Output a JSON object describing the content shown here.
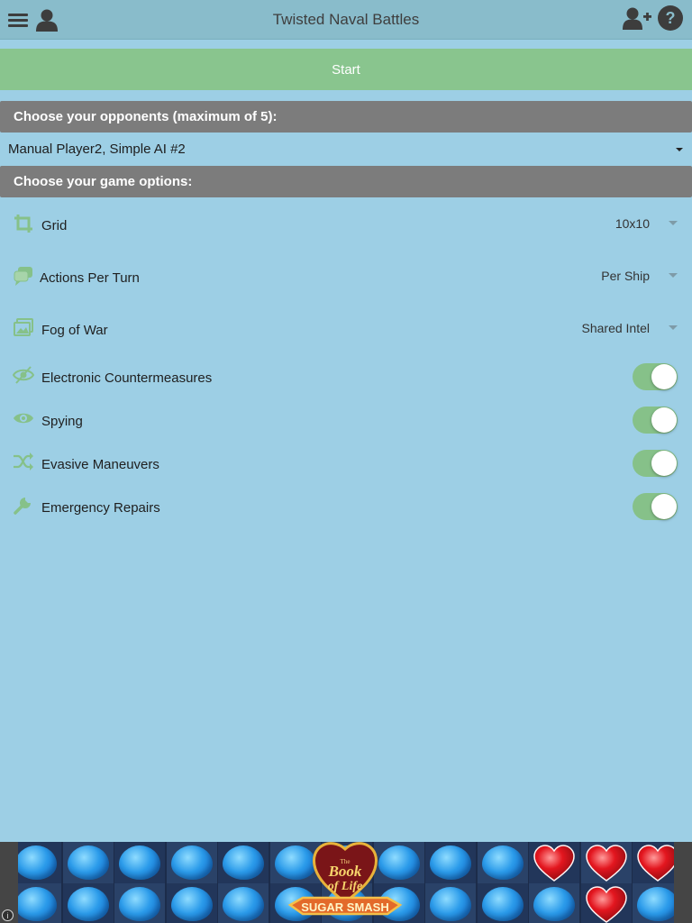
{
  "app": {
    "title": "Twisted Naval Battles"
  },
  "icons": {
    "menu": "hamburger-icon",
    "user": "user-icon",
    "add_user": "add-user-icon",
    "help": "help-icon"
  },
  "start": {
    "label": "Start"
  },
  "opponents": {
    "header": "Choose your opponents (maximum of 5):",
    "selected": "Manual Player2, Simple AI #2"
  },
  "options": {
    "header": "Choose your game options:",
    "selects": [
      {
        "label": "Grid",
        "value": "10x10",
        "icon": "crop-icon"
      },
      {
        "label": "Actions Per Turn",
        "value": "Per Ship",
        "icon": "chat-bubbles-icon"
      },
      {
        "label": "Fog of War",
        "value": "Shared Intel",
        "icon": "pictures-icon"
      }
    ],
    "toggles": [
      {
        "label": "Electronic Countermeasures",
        "on": true,
        "icon": "eye-slash-icon"
      },
      {
        "label": "Spying",
        "on": true,
        "icon": "eye-icon"
      },
      {
        "label": "Evasive Maneuvers",
        "on": true,
        "icon": "shuffle-icon"
      },
      {
        "label": "Emergency Repairs",
        "on": true,
        "icon": "wrench-icon"
      }
    ]
  },
  "ad": {
    "logo_text_line1": "The Book of Life",
    "logo_text_line2": "SUGAR SMASH",
    "info": "i"
  },
  "colors": {
    "background": "#9dcfe5",
    "topbar": "#89bccb",
    "start_button": "#89c58e",
    "section_header": "#7c7c7c",
    "toggle_on": "#86c189",
    "icon_green": "#86c189"
  }
}
